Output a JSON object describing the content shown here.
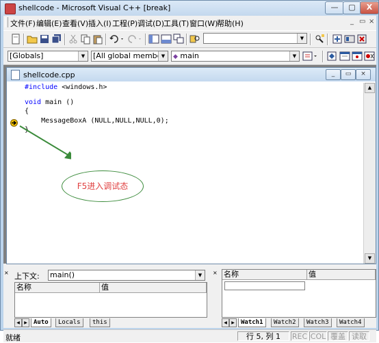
{
  "window": {
    "title": "shellcode - Microsoft Visual C++ [break]",
    "minimize": "—",
    "maximize": "▢",
    "close": "X"
  },
  "menu": {
    "items": [
      "文件(F)",
      "编辑(E)",
      "查看(V)",
      "插入(I)",
      "工程(P)",
      "调试(D)",
      "工具(T)",
      "窗口(W)",
      "帮助(H)"
    ],
    "mdi_controls": [
      "_",
      "▭",
      "×"
    ]
  },
  "toolbar2": {
    "scope": "[Globals]",
    "members": "[All global members",
    "function": "main"
  },
  "editor": {
    "title": "shellcode.cpp",
    "lines": [
      "#include <windows.h>",
      "",
      "void main ()",
      "{",
      "    MessageBoxA (NULL,NULL,NULL,0);",
      "}"
    ],
    "annotation": "F5进入调试态",
    "colors": {
      "keyword": "#0000ff",
      "annotation_text": "#e04040",
      "annotation_border": "#3b8b3b",
      "arrow": "#3b8b3b",
      "marker": "#f5c400"
    }
  },
  "variables_pane": {
    "context_label": "上下文:",
    "context_value": "main()",
    "columns": [
      "名称",
      "值"
    ],
    "tabs": [
      "Auto",
      "Locals",
      "this"
    ]
  },
  "watch_pane": {
    "columns": [
      "名称",
      "值"
    ],
    "tabs": [
      "Watch1",
      "Watch2",
      "Watch3",
      "Watch4"
    ]
  },
  "status": {
    "text": "就绪",
    "position": "行 5, 列 1",
    "indicators": [
      "REC",
      "COL",
      "覆盖",
      "读取"
    ]
  }
}
